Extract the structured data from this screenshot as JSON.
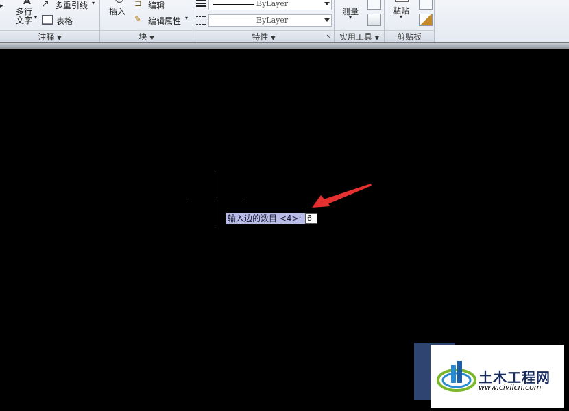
{
  "ribbon": {
    "annotation": {
      "title": "注释",
      "mtext_label": [
        "多行",
        "文字"
      ],
      "mleader_label": "多重引线",
      "table_label": "表格"
    },
    "block": {
      "title": "块",
      "insert_label": "插入",
      "edit_label": "编辑",
      "edit_attr_label": "编辑属性"
    },
    "properties": {
      "title": "特性",
      "lineweight_value": "ByLayer",
      "linetype_value": "ByLayer"
    },
    "utilities": {
      "title": "实用工具",
      "measure_label": "测量"
    },
    "clipboard": {
      "title": "剪贴板",
      "paste_label": "粘贴"
    }
  },
  "canvas": {
    "prompt_text": "输入边的数目 <4>:",
    "input_value": "6"
  },
  "watermark": {
    "brand": "土木工程网",
    "url": "www.civilcn.com"
  },
  "colors": {
    "canvas_bg": "#000000",
    "prompt_bg": "#b9bce8",
    "arrow": "#e53030",
    "watermark_blue": "#1a2c5c"
  }
}
